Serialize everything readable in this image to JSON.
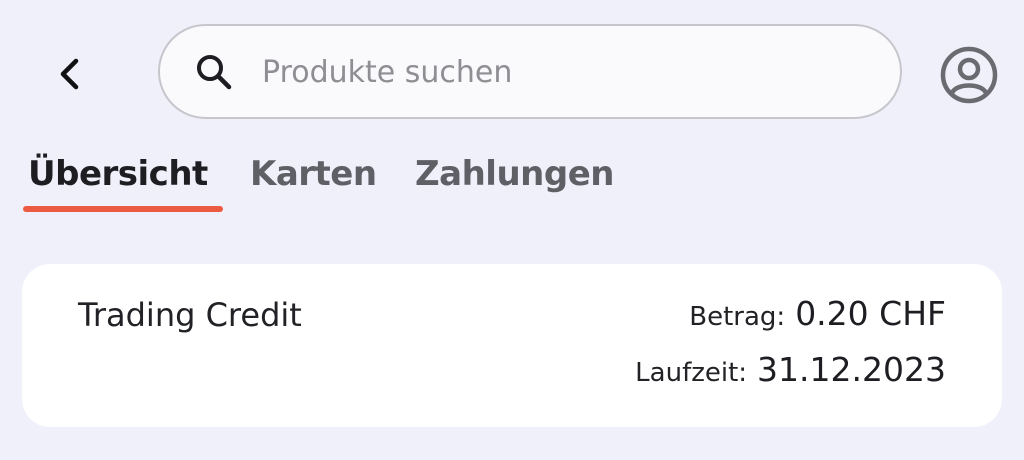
{
  "header": {
    "back_icon": "chevron-left-icon",
    "search": {
      "icon": "search-icon",
      "placeholder": "Produkte suchen",
      "value": ""
    },
    "profile_icon": "user-circle-icon"
  },
  "tabs": [
    {
      "label": "Übersicht",
      "active": true
    },
    {
      "label": "Karten",
      "active": false
    },
    {
      "label": "Zahlungen",
      "active": false
    }
  ],
  "colors": {
    "accent": "#ec5b41",
    "background": "#eff0fa",
    "card": "#ffffff"
  },
  "card": {
    "title": "Trading Credit",
    "amount_label": "Betrag:",
    "amount_value": "0.20 CHF",
    "term_label": "Laufzeit:",
    "term_value": "31.12.2023"
  }
}
